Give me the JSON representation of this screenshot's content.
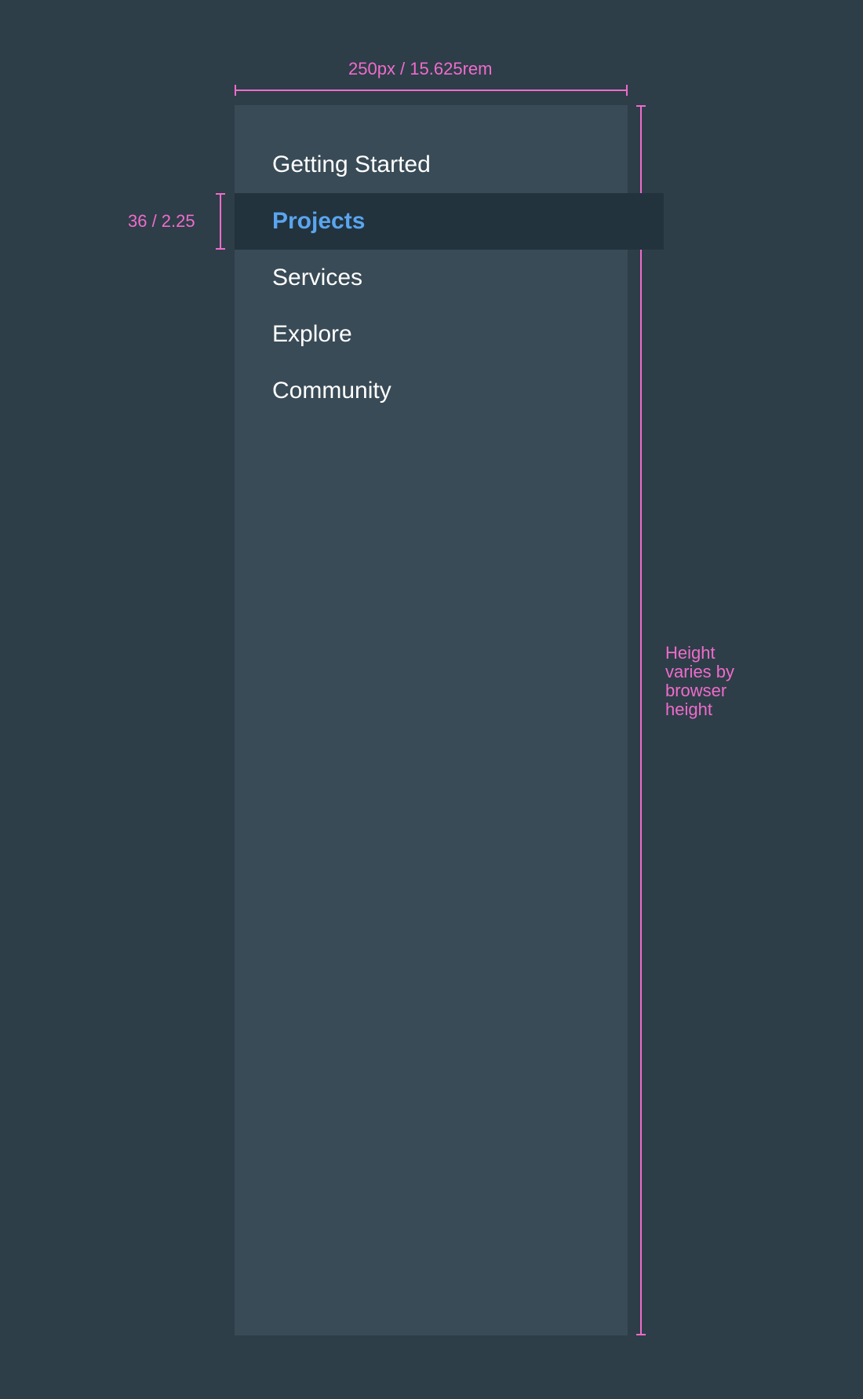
{
  "sidebar": {
    "items": [
      {
        "label": "Getting Started",
        "active": false
      },
      {
        "label": "Projects",
        "active": true
      },
      {
        "label": "Services",
        "active": false
      },
      {
        "label": "Explore",
        "active": false
      },
      {
        "label": "Community",
        "active": false
      }
    ]
  },
  "annotations": {
    "width_label": "250px / 15.625rem",
    "item_height_label": "36 / 2.25",
    "height_note": "Height varies by browser height"
  },
  "colors": {
    "page_background": "#2d3e48",
    "sidebar_background": "#394b56",
    "active_item_background": "#22333e",
    "active_item_text": "#5aa5ef",
    "item_text": "#ffffff",
    "annotation": "#f06bcc"
  }
}
